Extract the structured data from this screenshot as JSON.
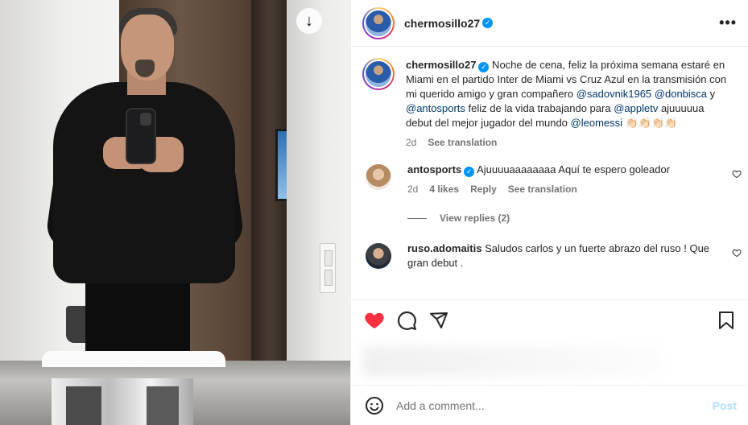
{
  "post": {
    "username": "chermosillo27",
    "verified": true
  },
  "caption": {
    "username": "chermosillo27",
    "text_1": " Noche de cena, feliz la próxima semana estaré en Miami en el partido Inter de Miami vs Cruz Azul en la transmisión con mi querido amigo y gran compañero ",
    "mention_1": "@sadovnik1965",
    "mention_2": "@donbisca",
    "text_2": " y ",
    "mention_3": "@antosports",
    "text_3": " feliz de la vida trabajando para ",
    "mention_4": "@appletv",
    "text_4": " ajuuuuua debut del mejor jugador del mundo ",
    "mention_5": "@leomessi",
    "emoji": " 👏🏻👏🏻👏🏻👏🏻",
    "time": "2d",
    "see_translation": "See translation"
  },
  "comments": [
    {
      "username": "antosports",
      "verified": true,
      "text": "Ajuuuuaaaaaaaa Aquí te espero goleador",
      "time": "2d",
      "likes": "4 likes",
      "reply": "Reply",
      "see_translation": "See translation",
      "view_replies": "View replies (2)"
    },
    {
      "username": "ruso.adomaitis",
      "verified": false,
      "text": "Saludos carlos y un fuerte abrazo del ruso ! Que gran debut ."
    }
  ],
  "comment_box": {
    "placeholder": "Add a comment...",
    "post_label": "Post"
  },
  "icons": {
    "like": "heart-filled-icon",
    "comment": "comment-icon",
    "share": "share-icon",
    "save": "bookmark-icon",
    "emoji": "emoji-icon",
    "more": "more-icon",
    "download": "download-icon"
  },
  "colors": {
    "like_red": "#ff3040",
    "verified_blue": "#0095f6",
    "mention_blue": "#00376b",
    "post_disabled": "#b2dffc"
  }
}
